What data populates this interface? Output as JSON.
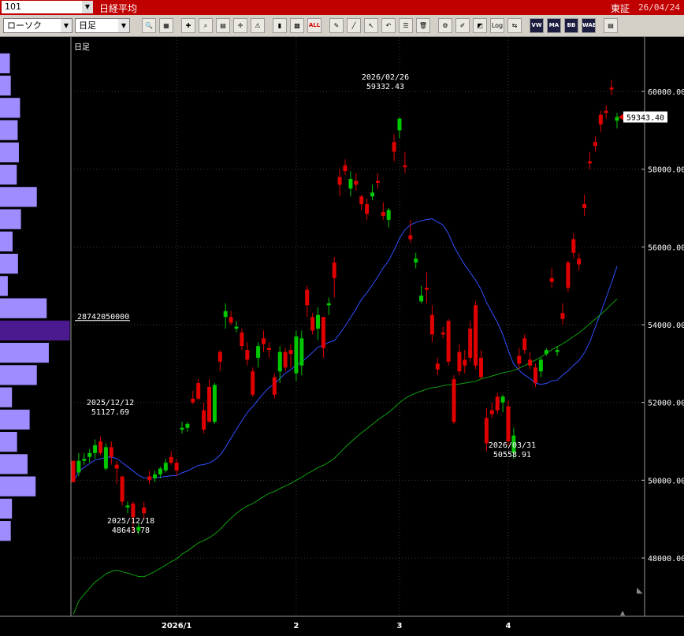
{
  "header": {
    "code": "101",
    "index_name": "日経平均",
    "market": "東証",
    "date": "26/04/24"
  },
  "toolbar": {
    "chart_type": "ローソク",
    "period": "日足",
    "buttons": [
      {
        "name": "zoom-icon",
        "label": "🔍"
      },
      {
        "name": "window-icon",
        "label": "▦"
      },
      {
        "name": "chart-add-icon",
        "label": "✚"
      },
      {
        "name": "search-icon",
        "label": "⌕"
      },
      {
        "name": "table-icon",
        "label": "▤"
      },
      {
        "name": "crosshair-icon",
        "label": "✛"
      },
      {
        "name": "warning-icon",
        "label": "⚠"
      },
      {
        "name": "candle-icon",
        "label": "▮"
      },
      {
        "name": "grid-icon",
        "label": "▩"
      },
      {
        "name": "all-icon",
        "label": "ALL"
      },
      {
        "name": "pen-icon",
        "label": "✎"
      },
      {
        "name": "line-tool-icon",
        "label": "╱"
      },
      {
        "name": "cursor-icon",
        "label": "↖"
      },
      {
        "name": "undo-icon",
        "label": "↶"
      },
      {
        "name": "list-icon",
        "label": "☰"
      },
      {
        "name": "trash-icon",
        "label": "🗑"
      },
      {
        "name": "settings-icon",
        "label": "⚙"
      },
      {
        "name": "edit-icon",
        "label": "✐"
      },
      {
        "name": "color-icon",
        "label": "◩"
      },
      {
        "name": "log-icon",
        "label": "Log"
      },
      {
        "name": "compare-icon",
        "label": "⇆"
      },
      {
        "name": "vwap-icon",
        "label": "VW"
      },
      {
        "name": "ma-icon",
        "label": "MA"
      },
      {
        "name": "bb-icon",
        "label": "BB"
      },
      {
        "name": "vwave-icon",
        "label": "WAE"
      },
      {
        "name": "layout-icon",
        "label": "▤"
      }
    ]
  },
  "chart_data": {
    "type": "candlestick",
    "title": "日足",
    "ylim": [
      46500,
      61400
    ],
    "y_ticks": [
      "60000.00",
      "58000.00",
      "56000.00",
      "54000.00",
      "52000.00",
      "50000.00",
      "48000.00"
    ],
    "x_ticks": [
      "2026/1",
      "2",
      "3",
      "4"
    ],
    "current_price": "59343.40",
    "volume_profile_label": "28742050000",
    "annotations": [
      {
        "date": "2025/12/12",
        "price": "51127.69"
      },
      {
        "date": "2025/12/18",
        "price": "48643.78"
      },
      {
        "date": "2026/02/26",
        "price": "59332.43"
      },
      {
        "date": "2026/03/31",
        "price": "50558.91"
      }
    ],
    "colors": {
      "up": "#00c800",
      "down": "#e00000",
      "ma_short": "#3050ff",
      "ma_long": "#10a010",
      "profile": "#9f8cff",
      "profile_peak": "#4b1a8f"
    },
    "candles": [
      [
        50500,
        50500,
        49950,
        49950
      ],
      [
        50200,
        50700,
        50100,
        50500
      ],
      [
        50500,
        50700,
        50400,
        50550
      ],
      [
        50600,
        50800,
        50450,
        50700
      ],
      [
        50700,
        51050,
        50550,
        50900
      ],
      [
        51000,
        51127,
        50650,
        50700
      ],
      [
        50300,
        50950,
        50250,
        50850
      ],
      [
        50850,
        51000,
        50400,
        50600
      ],
      [
        50400,
        50500,
        49900,
        50300
      ],
      [
        50100,
        50100,
        49350,
        49450
      ],
      [
        49300,
        49450,
        49150,
        49350
      ],
      [
        49400,
        49450,
        48644,
        49050
      ],
      [
        48700,
        48900,
        48600,
        48800
      ],
      [
        49300,
        49450,
        49000,
        49150
      ],
      [
        50100,
        50250,
        49900,
        50000
      ],
      [
        50050,
        50250,
        49950,
        50150
      ],
      [
        50150,
        50350,
        50050,
        50300
      ],
      [
        50250,
        50550,
        50200,
        50450
      ],
      [
        50600,
        50750,
        50400,
        50450
      ],
      [
        50450,
        50550,
        50100,
        50250
      ],
      [
        51300,
        51500,
        51200,
        51350
      ],
      [
        51350,
        51500,
        51250,
        51450
      ],
      [
        52100,
        52300,
        51950,
        52000
      ],
      [
        52500,
        52600,
        52050,
        52100
      ],
      [
        51800,
        52000,
        51200,
        51300
      ],
      [
        52400,
        52600,
        51600,
        51500
      ],
      [
        51500,
        52500,
        51450,
        52450
      ],
      [
        53300,
        53350,
        52800,
        53050
      ],
      [
        54200,
        54550,
        53900,
        54350
      ],
      [
        54200,
        54350,
        54000,
        54050
      ],
      [
        53900,
        54100,
        53800,
        53950
      ],
      [
        53800,
        53900,
        53350,
        53450
      ],
      [
        53350,
        53550,
        52950,
        53100
      ],
      [
        52800,
        52900,
        52150,
        52200
      ],
      [
        53150,
        53550,
        52900,
        53450
      ],
      [
        53650,
        53850,
        53300,
        53500
      ],
      [
        53400,
        53550,
        53150,
        53350
      ],
      [
        52650,
        52750,
        52100,
        52200
      ],
      [
        52800,
        53450,
        52500,
        53300
      ],
      [
        53300,
        53400,
        52800,
        52900
      ],
      [
        53350,
        53500,
        52900,
        53250
      ],
      [
        52750,
        53850,
        52550,
        53700
      ],
      [
        52950,
        53850,
        52700,
        53650
      ],
      [
        54900,
        55000,
        54200,
        54500
      ],
      [
        54200,
        54300,
        53750,
        53850
      ],
      [
        53900,
        54450,
        53600,
        54250
      ],
      [
        54200,
        54200,
        53150,
        53400
      ],
      [
        54500,
        54700,
        54250,
        54550
      ],
      [
        55600,
        55750,
        54700,
        55200
      ],
      [
        57800,
        58000,
        57300,
        57600
      ],
      [
        58100,
        58250,
        57850,
        57950
      ],
      [
        57500,
        57950,
        57300,
        57750
      ],
      [
        57700,
        57900,
        57450,
        57600
      ],
      [
        57300,
        57350,
        56950,
        57100
      ],
      [
        57100,
        57250,
        56700,
        56850
      ],
      [
        57300,
        57600,
        57200,
        57400
      ],
      [
        57700,
        57900,
        57500,
        57650
      ],
      [
        56900,
        57150,
        56700,
        56800
      ],
      [
        56700,
        57000,
        56500,
        56950
      ],
      [
        58700,
        58900,
        58200,
        58450
      ],
      [
        59000,
        59332,
        58800,
        59300
      ],
      [
        58100,
        58450,
        57900,
        58050
      ],
      [
        56300,
        56700,
        56100,
        56200
      ],
      [
        55600,
        55850,
        55450,
        55700
      ],
      [
        54600,
        55000,
        54550,
        54750
      ],
      [
        54950,
        55350,
        54550,
        54900
      ],
      [
        54250,
        54500,
        53550,
        53750
      ],
      [
        53000,
        53150,
        52700,
        52850
      ],
      [
        53800,
        53950,
        53650,
        53750
      ],
      [
        54100,
        54150,
        52950,
        53050
      ],
      [
        52600,
        52700,
        51450,
        51500
      ],
      [
        53300,
        53500,
        52700,
        52800
      ],
      [
        53100,
        53350,
        52750,
        52950
      ],
      [
        53900,
        54100,
        53050,
        53150
      ],
      [
        54500,
        54600,
        52850,
        52950
      ],
      [
        53150,
        53350,
        52600,
        52650
      ],
      [
        51600,
        51850,
        50750,
        50950
      ],
      [
        51800,
        52000,
        51600,
        51700
      ],
      [
        52150,
        52250,
        51700,
        51800
      ],
      [
        52000,
        52200,
        51750,
        52150
      ],
      [
        51900,
        52050,
        50900,
        51000
      ],
      [
        50700,
        51350,
        50550,
        51150
      ],
      [
        53200,
        53400,
        52850,
        53000
      ],
      [
        53650,
        53750,
        53250,
        53350
      ],
      [
        53100,
        53300,
        52850,
        52950
      ],
      [
        52900,
        53000,
        52400,
        52500
      ],
      [
        52800,
        53150,
        52650,
        53100
      ],
      [
        53250,
        53400,
        53200,
        53350
      ],
      [
        55200,
        55450,
        54950,
        55100
      ],
      [
        53300,
        53450,
        53200,
        53350
      ],
      [
        54300,
        54550,
        54000,
        54150
      ],
      [
        55600,
        55650,
        54850,
        54950
      ],
      [
        56200,
        56350,
        55700,
        55850
      ],
      [
        55700,
        55850,
        55400,
        55550
      ],
      [
        57100,
        57350,
        56800,
        57000
      ],
      [
        58200,
        58450,
        58000,
        58150
      ],
      [
        58700,
        58850,
        58450,
        58600
      ],
      [
        59400,
        59500,
        58950,
        59150
      ],
      [
        59500,
        59650,
        59300,
        59450
      ],
      [
        60100,
        60300,
        59900,
        60050
      ],
      [
        59250,
        59450,
        59050,
        59343
      ]
    ],
    "volume_profile": [
      0.33,
      0.36,
      0.67,
      0.59,
      0.63,
      0.56,
      1.23,
      0.7,
      0.42,
      0.6,
      0.26,
      1.56,
      2.33,
      1.63,
      1.23,
      0.4,
      0.99,
      0.57,
      0.92,
      1.19,
      0.4,
      0.36
    ]
  }
}
